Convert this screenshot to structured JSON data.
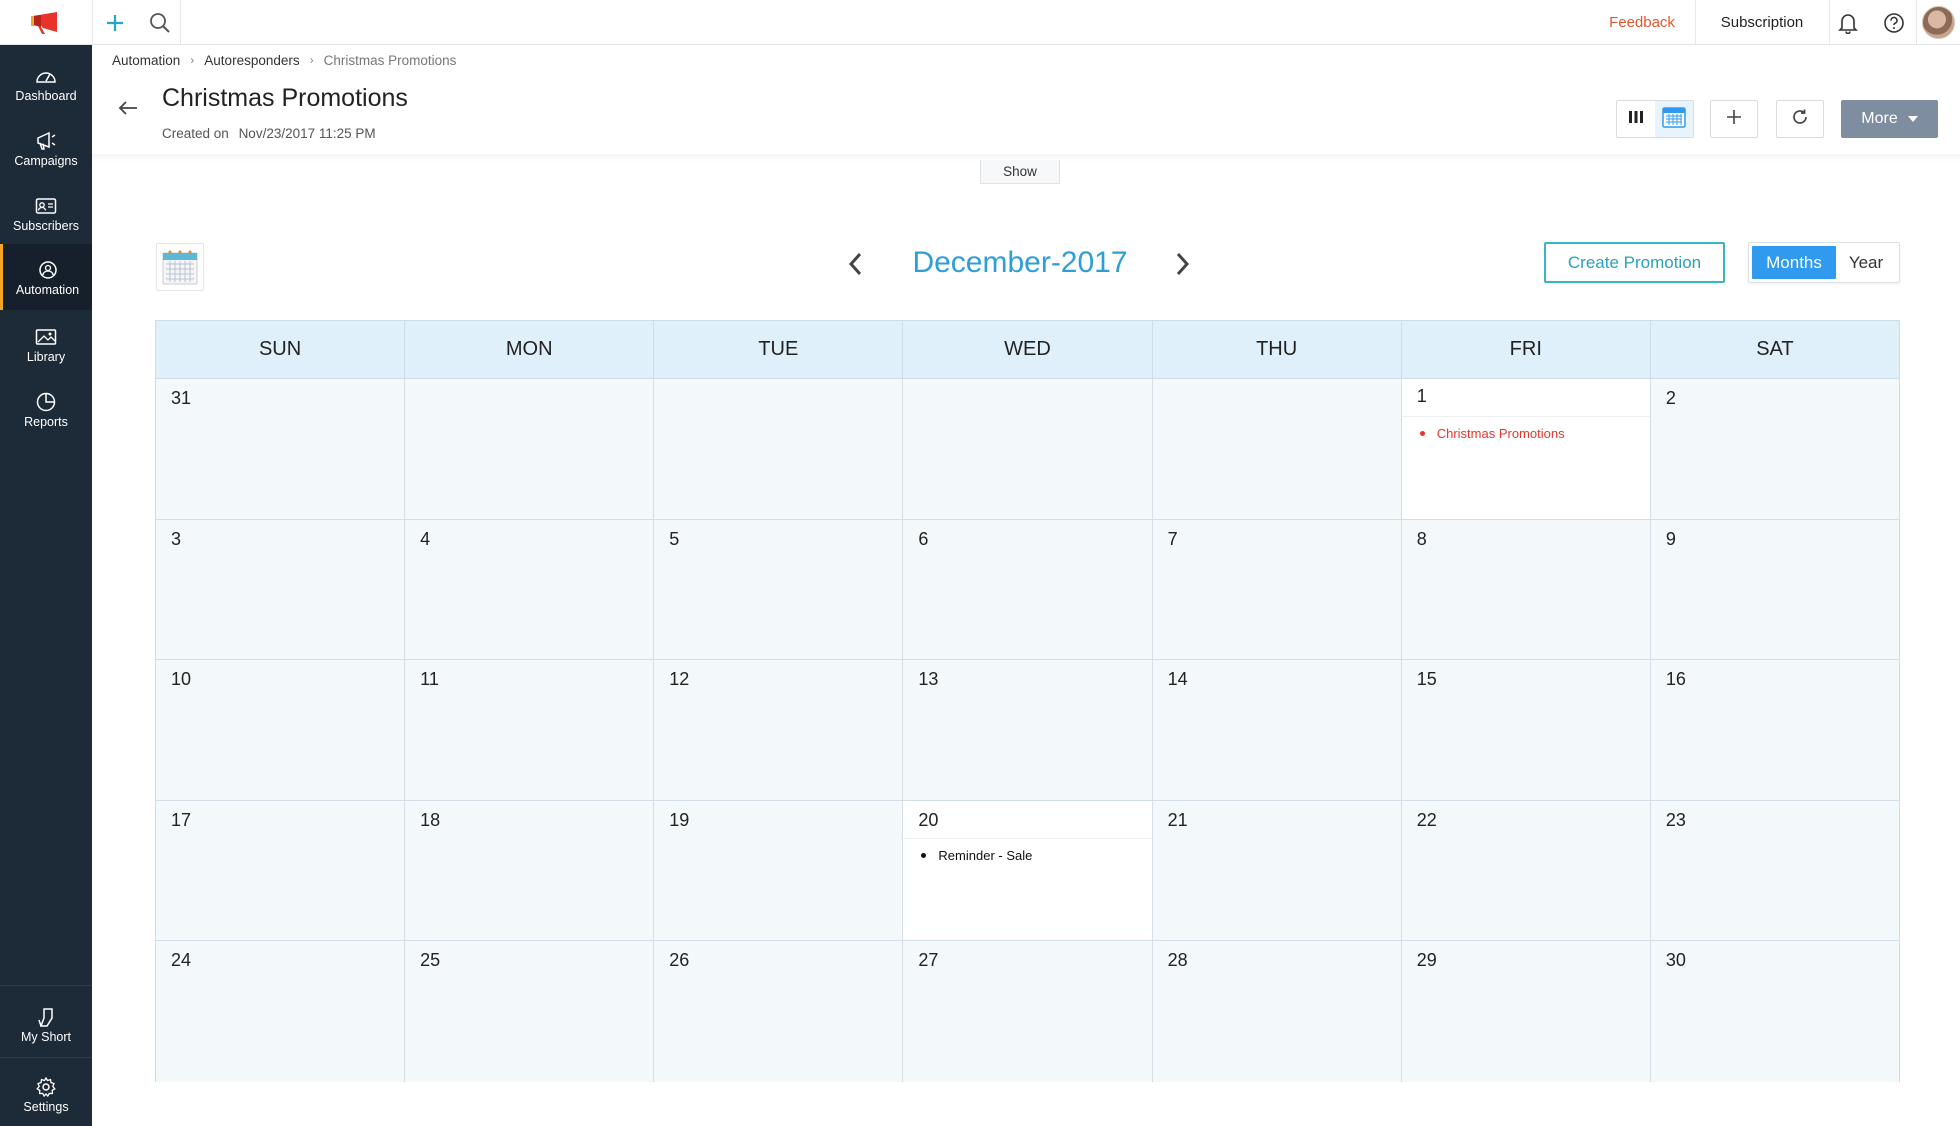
{
  "topbar": {
    "feedback_label": "Feedback",
    "subscription_label": "Subscription"
  },
  "sidebar": {
    "items": [
      {
        "label": "Dashboard",
        "icon": "dashboard-icon"
      },
      {
        "label": "Campaigns",
        "icon": "megaphone-icon"
      },
      {
        "label": "Subscribers",
        "icon": "contact-card-icon"
      },
      {
        "label": "Automation",
        "icon": "automation-icon",
        "active": true
      },
      {
        "label": "Library",
        "icon": "image-icon"
      },
      {
        "label": "Reports",
        "icon": "pie-chart-icon"
      }
    ],
    "bottom_items": [
      {
        "label": "My Short",
        "icon": "shortcut-icon"
      },
      {
        "label": "Settings",
        "icon": "gear-icon"
      }
    ]
  },
  "breadcrumb": [
    "Automation",
    "Autoresponders",
    "Christmas Promotions"
  ],
  "header": {
    "title": "Christmas Promotions",
    "created_label": "Created on",
    "created_value": "Nov/23/2017 11:25 PM",
    "more_label": "More",
    "show_label": "Show"
  },
  "calendar": {
    "month_title": "December-2017",
    "create_button": "Create Promotion",
    "range_months": "Months",
    "range_year": "Year",
    "weekdays": [
      "SUN",
      "MON",
      "TUE",
      "WED",
      "THU",
      "FRI",
      "SAT"
    ],
    "weeks": [
      [
        "31",
        "",
        "",
        "",
        "",
        "1",
        "2"
      ],
      [
        "3",
        "4",
        "5",
        "6",
        "7",
        "8",
        "9"
      ],
      [
        "10",
        "11",
        "12",
        "13",
        "14",
        "15",
        "16"
      ],
      [
        "17",
        "18",
        "19",
        "20",
        "21",
        "22",
        "23"
      ],
      [
        "24",
        "25",
        "26",
        "27",
        "28",
        "29",
        "30"
      ]
    ],
    "events": [
      {
        "week": 0,
        "day": 5,
        "label": "Christmas Promotions",
        "color": "#e8352b"
      },
      {
        "week": 3,
        "day": 3,
        "label": "Reminder - Sale",
        "color": "#111111"
      }
    ]
  },
  "colors": {
    "sidebar_bg": "#1d2a38",
    "accent_blue": "#2d9ed8",
    "active_indicator": "#f5a623",
    "feedback": "#e4572e",
    "teal": "#35b6c2"
  }
}
